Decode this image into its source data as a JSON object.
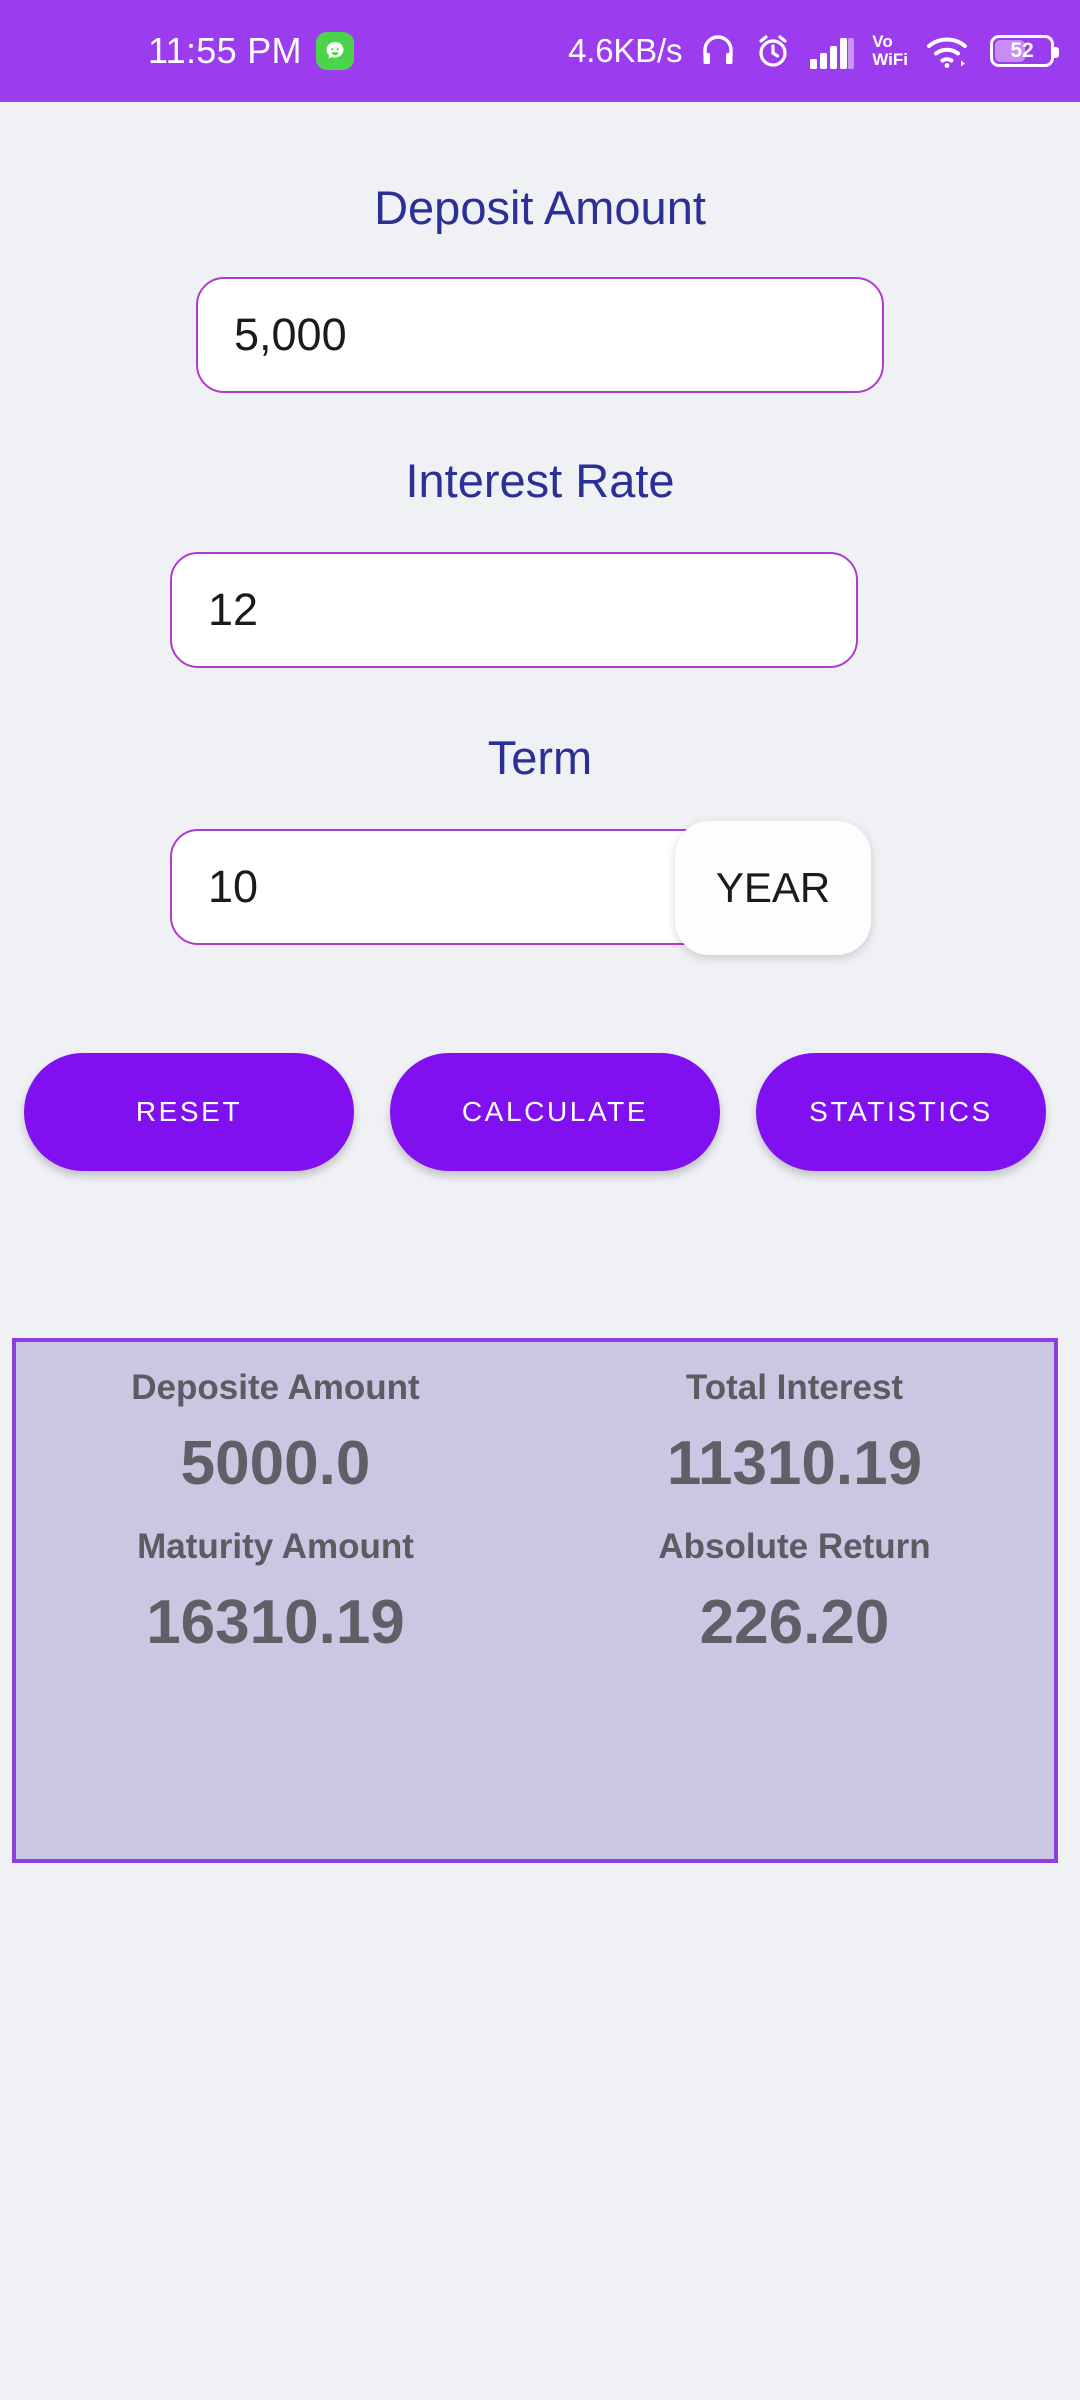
{
  "status_bar": {
    "time": "11:55 PM",
    "app_badge_icon": "whatsapp-icon",
    "network_speed": "4.6KB/s",
    "headphone_icon": "headphone-icon",
    "alarm_icon": "alarm-clock-icon",
    "signal_icon": "cellular-signal-icon",
    "vo_label": "Vo",
    "wifi_label": "WiFi",
    "wifi_icon": "wifi-icon",
    "battery_level": "52",
    "bar_color": "#9b3cef"
  },
  "form": {
    "deposit": {
      "label": "Deposit Amount",
      "value": "5,000",
      "placeholder": "Deposit Amount"
    },
    "rate": {
      "label": "Interest Rate",
      "value": "12",
      "placeholder": "Interest Rate"
    },
    "term": {
      "label": "Term",
      "value": "10",
      "placeholder": "Term",
      "unit": "YEAR"
    }
  },
  "buttons": {
    "reset": "RESET",
    "calculate": "CALCULATE",
    "statistics": "STATISTICS",
    "color": "#8110f0"
  },
  "results": {
    "panel_bg": "#cbc6e2",
    "panel_border": "#8d3ee0",
    "cells": [
      {
        "title": "Deposite Amount",
        "value": "5000.0"
      },
      {
        "title": "Total Interest",
        "value": "11310.19"
      },
      {
        "title": "Maturity Amount",
        "value": "16310.19"
      },
      {
        "title": "Absolute Return",
        "value": "226.20"
      }
    ]
  },
  "theme": {
    "background": "#eff1f5",
    "label_color": "#2b2f96",
    "input_border": "#b23ad0"
  }
}
